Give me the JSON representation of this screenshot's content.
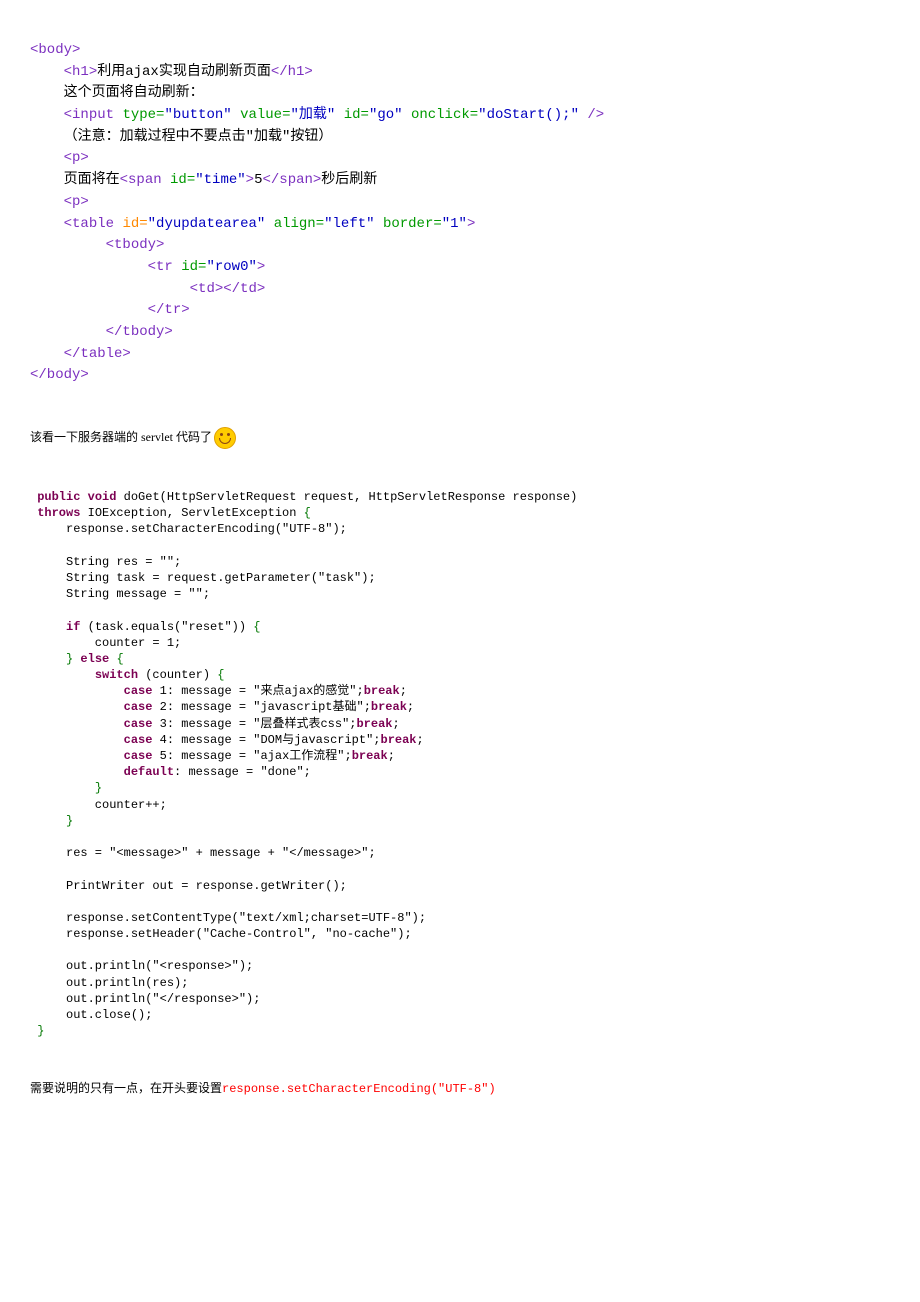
{
  "block1": {
    "l1": {
      "text": "<body>"
    },
    "l2": {
      "indent": "    ",
      "open": "<h1>",
      "content": "利用ajax实现自动刷新页面",
      "close": "</h1>"
    },
    "l3": {
      "indent": "    ",
      "text": "这个页面将自动刷新："
    },
    "l4": {
      "indent": "    ",
      "t_input": "<input",
      "a_type": "type=",
      "v_type": "\"button\"",
      "a_value": "value=",
      "v_value": "\"加载\"",
      "a_id": "id=",
      "v_id": "\"go\"",
      "a_onclick": "onclick=",
      "v_onclick": "\"doStart();\"",
      "t_close": "/>"
    },
    "l5": {
      "indent": "    ",
      "text": "（注意：加载过程中不要点击\"加载\"按钮）"
    },
    "l6": {
      "indent": "    ",
      "text": "<p>"
    },
    "l7": {
      "indent": "    ",
      "t1": "页面将在",
      "open": "<span",
      "a_id": "id=",
      "v_id": "\"time\"",
      "close": ">",
      "num": "5",
      "end": "</span>",
      "t2": "秒后刷新"
    },
    "l8": {
      "indent": "    ",
      "text": "<p>"
    },
    "l9": {
      "indent": "    ",
      "open": "<table",
      "a_id": "id=",
      "v_id": "\"dyupdatearea\"",
      "a_align": "align=",
      "v_align": "\"left\"",
      "a_border": "border=",
      "v_border": "\"1\"",
      "close": ">"
    },
    "l10": {
      "indent": "         ",
      "text": "<tbody>"
    },
    "l11": {
      "indent": "              ",
      "open": "<tr",
      "a_id": "id=",
      "v_id": "\"row0\"",
      "close": ">"
    },
    "l12": {
      "indent": "                   ",
      "open": "<td>",
      "close": "</td>"
    },
    "l13": {
      "indent": "              ",
      "text": "</tr>"
    },
    "l14": {
      "indent": "         ",
      "text": "</tbody>"
    },
    "l15": {
      "indent": "    ",
      "text": "</table>"
    },
    "l16": {
      "text": "</body>"
    }
  },
  "caption1": "该看一下服务器端的 servlet 代码了",
  "block2": {
    "l1": {
      "kw1": "public",
      "kw2": "void",
      "rest": " doGet(HttpServletRequest request, HttpServletResponse response)"
    },
    "l2": {
      "kw1": "throws",
      "rest": " IOException, ServletException "
    },
    "l3": "     response.setCharacterEncoding(\"UTF-8\");",
    "l4": "",
    "l5": "     String res = \"\";",
    "l6": "     String task = request.getParameter(\"task\");",
    "l7": "     String message = \"\";",
    "l8": "",
    "l9": {
      "pre": "     ",
      "kw": "if",
      "rest": " (task.equals(\"reset\")) "
    },
    "l10": "         counter = 1;",
    "l11": {
      "pre": "     ",
      "close": " ",
      "kw": "else",
      "rest": " "
    },
    "l12": {
      "pre": "         ",
      "kw": "switch",
      "rest": " (counter) "
    },
    "c1": {
      "pre": "             ",
      "kw1": "case",
      "n": " 1: message = ",
      "str": "\"来点ajax的感觉\"",
      "semi": ";",
      "kw2": "break",
      "end": ";"
    },
    "c2": {
      "pre": "             ",
      "kw1": "case",
      "n": " 2: message = ",
      "str": "\"javascript基础\"",
      "semi": ";",
      "kw2": "break",
      "end": ";"
    },
    "c3": {
      "pre": "             ",
      "kw1": "case",
      "n": " 3: message = ",
      "str": "\"层叠样式表css\"",
      "semi": ";",
      "kw2": "break",
      "end": ";"
    },
    "c4": {
      "pre": "             ",
      "kw1": "case",
      "n": " 4: message = ",
      "str": "\"DOM与javascript\"",
      "semi": ";",
      "kw2": "break",
      "end": ";"
    },
    "c5": {
      "pre": "             ",
      "kw1": "case",
      "n": " 5: message = ",
      "str": "\"ajax工作流程\"",
      "semi": ";",
      "kw2": "break",
      "end": ";"
    },
    "cd": {
      "pre": "             ",
      "kw1": "default",
      "rest": ": message = \"done\";"
    },
    "l13": "         ",
    "l14": "         counter++;",
    "l15": "     ",
    "l16": "",
    "l17": "     res = \"<message>\" + message + \"</message>\";",
    "l18": "",
    "l19": "     PrintWriter out = response.getWriter();",
    "l20": "",
    "l21": "     response.setContentType(\"text/xml;charset=UTF-8\");",
    "l22": "     response.setHeader(\"Cache-Control\", \"no-cache\");",
    "l23": "",
    "l24": "     out.println(\"<response>\");",
    "l25": "     out.println(res);",
    "l26": "     out.println(\"</response>\");",
    "l27": "     out.close();",
    "l28": " "
  },
  "footer": {
    "text1": "需要说明的只有一点，在开头要设置",
    "text2": "response.setCharacterEncoding(\"UTF-8\")"
  }
}
